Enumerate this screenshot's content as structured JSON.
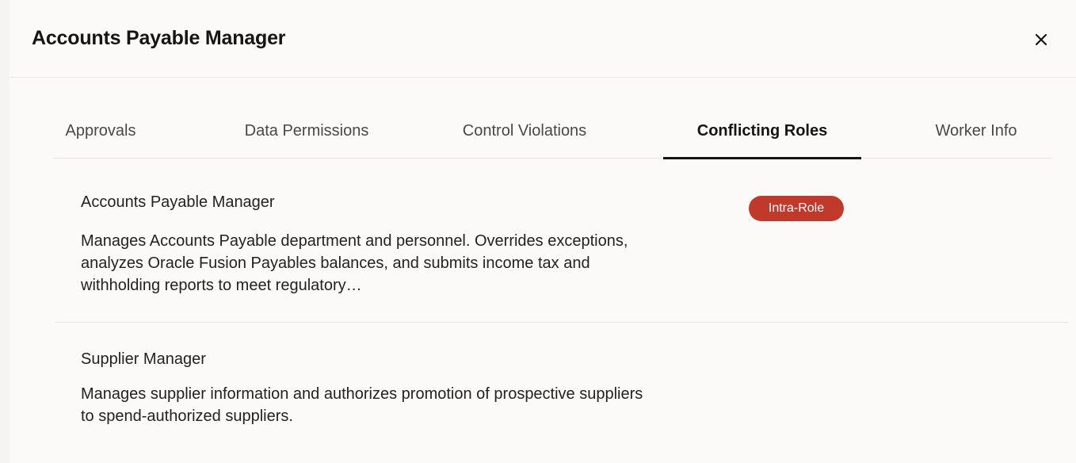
{
  "dialog": {
    "title": "Accounts Payable Manager",
    "close_icon": "close-icon"
  },
  "tabs": [
    {
      "label": "Approvals",
      "active": false
    },
    {
      "label": "Data Permissions",
      "active": false
    },
    {
      "label": "Control Violations",
      "active": false
    },
    {
      "label": "Conflicting Roles",
      "active": true
    },
    {
      "label": "Worker Info",
      "active": false
    }
  ],
  "roles": [
    {
      "name": "Accounts Payable Manager",
      "description": "Manages Accounts Payable department and personnel. Overrides exceptions, analyzes Oracle Fusion Payables balances, and submits income tax and withholding reports to meet regulatory…",
      "badge": "Intra-Role"
    },
    {
      "name": "Supplier Manager",
      "description": "Manages supplier information and authorizes promotion of prospective suppliers to spend-authorized suppliers."
    }
  ],
  "colors": {
    "badge_bg": "#c0392b",
    "active_tab_underline": "#161513"
  }
}
